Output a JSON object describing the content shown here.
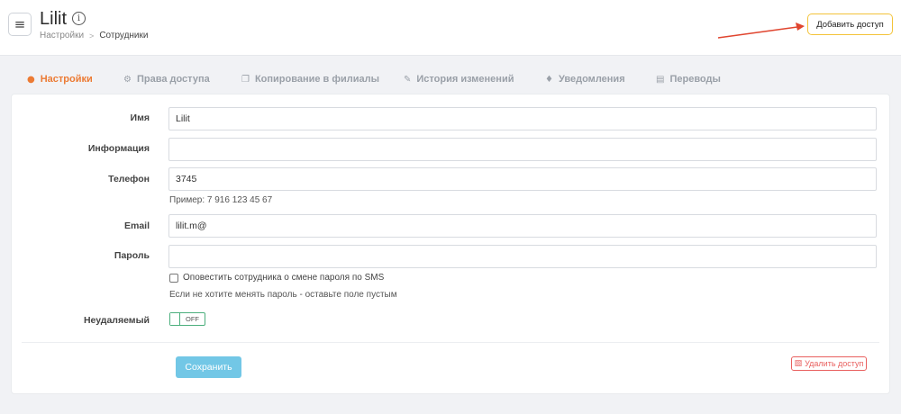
{
  "header": {
    "title": "Lilit",
    "breadcrumb": [
      "Настройки",
      "Сотрудники"
    ],
    "add_access_label": "Добавить доступ"
  },
  "tabs": [
    {
      "label": "Настройки",
      "icon": "user-icon",
      "active": true
    },
    {
      "label": "Права доступа",
      "icon": "gears-icon",
      "active": false
    },
    {
      "label": "Копирование в филиалы",
      "icon": "copy-icon",
      "active": false
    },
    {
      "label": "История изменений",
      "icon": "edit-icon",
      "active": false
    },
    {
      "label": "Уведомления",
      "icon": "bell-icon",
      "active": false
    },
    {
      "label": "Переводы",
      "icon": "transfer-icon",
      "active": false
    }
  ],
  "form": {
    "name": {
      "label": "Имя",
      "value": "Lilit"
    },
    "info": {
      "label": "Информация",
      "value": ""
    },
    "phone": {
      "label": "Телефон",
      "value": "3745",
      "hint": "Пример: 7 916 123 45 67"
    },
    "email": {
      "label": "Email",
      "value": "lilit.m@"
    },
    "password": {
      "label": "Пароль",
      "value": ""
    },
    "sms_notify_label": "Оповестить сотрудника о смене пароля по SMS",
    "password_hint": "Если не хотите менять пароль - оставьте поле пустым",
    "undeletable": {
      "label": "Неудаляемый",
      "toggle_text": "OFF"
    }
  },
  "actions": {
    "save_label": "Сохранить",
    "delete_label": "Удалить доступ"
  },
  "colors": {
    "accent": "#ec7b34",
    "save": "#72c7e6",
    "delete": "#e9605f",
    "highlight_border": "#f3c33a",
    "toggle": "#4caf7d",
    "arrow": "#e0452f"
  }
}
